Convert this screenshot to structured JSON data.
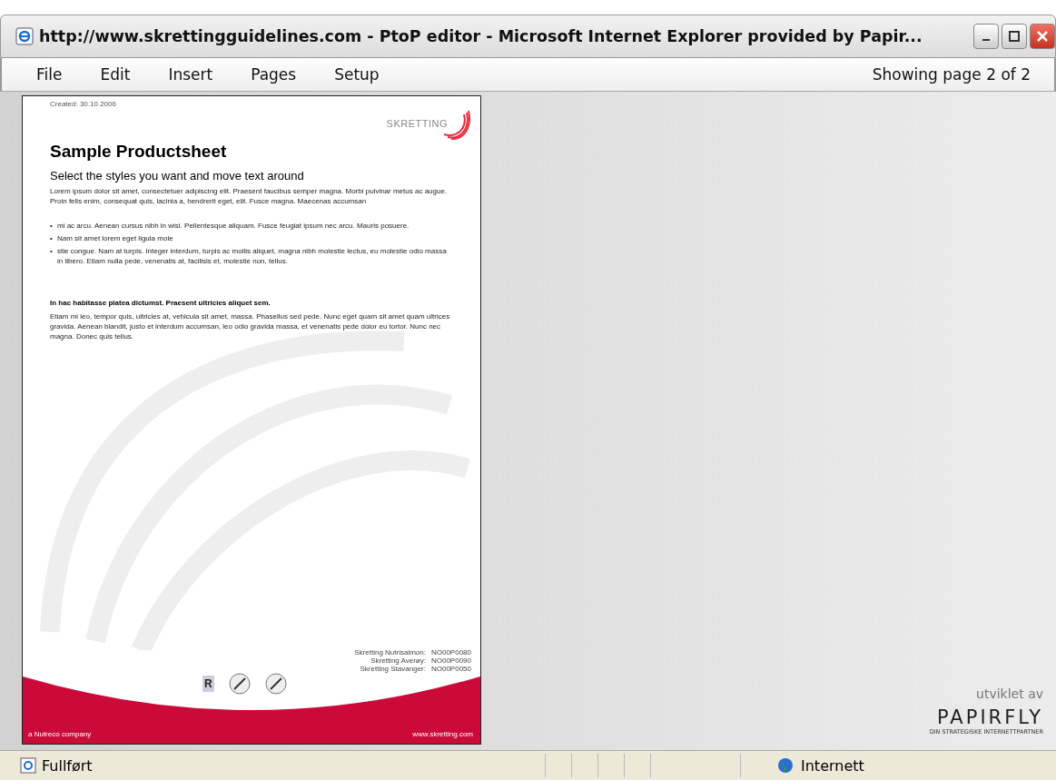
{
  "window": {
    "title": "http://www.skrettingguidelines.com - PtoP editor - Microsoft Internet Explorer provided by Papir..."
  },
  "menu": [
    {
      "label": "File"
    },
    {
      "label": "Edit"
    },
    {
      "label": "Insert"
    },
    {
      "label": "Pages"
    },
    {
      "label": "Setup"
    }
  ],
  "page_indicator": "Showing page 2 of 2",
  "document": {
    "date": "Created: 30.10.2006",
    "logo_text": "SKRETTING",
    "title": "Sample Productsheet",
    "subtitle": "Select the styles you want and move text around",
    "intro": "Lorem ipsum dolor sit amet, consectetuer adipiscing elit. Praesent faucibus semper magna. Morbi pulvinar metus ac augue. Proin felis enim, consequat quis, lacinia a, hendrerit eget, elit. Fusce magna. Maecenas accumsan",
    "bullets": [
      "mi ac arcu. Aenean cursus nibh in wisi. Pellentesque aliquam. Fusce feugiat ipsum nec arcu. Mauris posuere.",
      "Nam sit amet lorem eget ligula mole",
      "stie congue. Nam at turpis. Integer interdum, turpis ac mollis aliquet, magna nibh molestie lectus, eu molestie odio massa in libero. Etiam nulla pede, venenatis at, facilisis et, molestie non, tellus."
    ],
    "bold_line": "In hac habitasse platea dictumst. Praesent ultricies aliquet sem.",
    "closing": "Etiam mi leo, tempor quis, ultricies at, vehicula sit amet, massa. Phasellus sed pede. Nunc eget quam sit amet quam ultrices gravida. Aenean blandit, justo et interdum accumsan, leo odio gravida massa, et venenatis pede dolor eu tortor. Nunc nec magna. Donec quis tellus.",
    "codes": [
      {
        "name": "Skretting Nutrisalmon:",
        "code": "NO00P0080"
      },
      {
        "name": "Skretting Averøy:",
        "code": "NO00P0090"
      },
      {
        "name": "Skretting Stavanger:",
        "code": "NO00P0050"
      }
    ],
    "cert_mark": "R",
    "bullet_marker": "•",
    "footer_left": "a Nutreco company",
    "footer_right": "www.skretting.com"
  },
  "credit": {
    "label": "utviklet av",
    "brand": "PAPIRFLY",
    "tagline": "DIN STRATEGISKE INTERNETTPARTNER"
  },
  "status_bar": {
    "status": "Fullført",
    "zone": "Internett"
  }
}
